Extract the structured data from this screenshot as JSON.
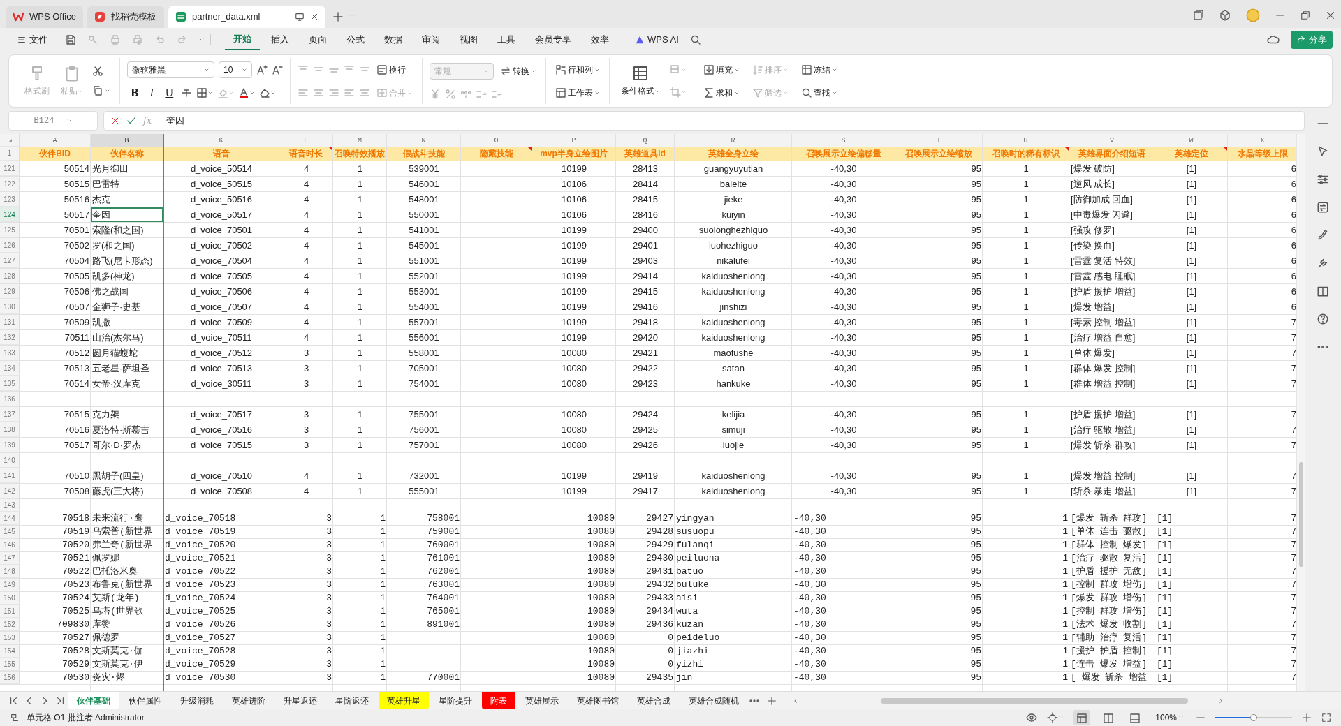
{
  "title_tabs": [
    {
      "label": "WPS Office",
      "selected": false
    },
    {
      "label": "找稻壳模板",
      "selected": false
    },
    {
      "label": "partner_data.xml",
      "selected": true
    }
  ],
  "menu": {
    "file": "文件",
    "tabs": [
      {
        "label": "开始",
        "selected": true
      },
      {
        "label": "插入",
        "selected": false
      },
      {
        "label": "页面",
        "selected": false
      },
      {
        "label": "公式",
        "selected": false
      },
      {
        "label": "数据",
        "selected": false
      },
      {
        "label": "审阅",
        "selected": false
      },
      {
        "label": "视图",
        "selected": false
      },
      {
        "label": "工具",
        "selected": false
      },
      {
        "label": "会员专享",
        "selected": false
      },
      {
        "label": "效率",
        "selected": false
      }
    ],
    "ai": "WPS AI",
    "share": "分享"
  },
  "ribbon": {
    "clipboard": [
      {
        "label": "格式刷",
        "disabled": true
      },
      {
        "label": "粘贴",
        "disabled": true
      }
    ],
    "font": {
      "family": "微软雅黑",
      "size": "10",
      "styles": [
        "B",
        "I",
        "U"
      ]
    },
    "align": [
      {
        "label": "换行",
        "disabled": false
      },
      {
        "label": "合并",
        "disabled": true
      }
    ],
    "number": {
      "format": "常规",
      "format_disabled": true,
      "convert": "转换"
    },
    "tools": [
      {
        "label": "行和列",
        "disabled": false
      },
      {
        "label": "工作表",
        "disabled": false
      }
    ],
    "conditional": "条件格式",
    "edit": [
      {
        "label": "填充",
        "disabled": false
      },
      {
        "label": "排序",
        "disabled": true
      },
      {
        "label": "冻结",
        "disabled": false
      },
      {
        "label": "求和",
        "disabled": false
      },
      {
        "label": "筛选",
        "disabled": true
      },
      {
        "label": "查找",
        "disabled": false
      }
    ]
  },
  "formula_bar": {
    "cell": "B124",
    "fx": "fx",
    "value": "奎因"
  },
  "sheet": {
    "columns": [
      {
        "letter": "A",
        "header": "伙伴BID",
        "comment": false,
        "selected": false
      },
      {
        "letter": "B",
        "header": "伙伴名称",
        "comment": false,
        "selected": true
      },
      {
        "letter": "K",
        "header": "语音",
        "comment": false,
        "selected": false
      },
      {
        "letter": "L",
        "header": "语音时长",
        "comment": true,
        "selected": false
      },
      {
        "letter": "M",
        "header": "召唤特效播放",
        "comment": false,
        "selected": false
      },
      {
        "letter": "N",
        "header": "假战斗技能",
        "comment": false,
        "selected": false
      },
      {
        "letter": "O",
        "header": "隐藏技能",
        "comment": true,
        "selected": false
      },
      {
        "letter": "P",
        "header": "mvp半身立绘图片",
        "comment": false,
        "selected": false
      },
      {
        "letter": "Q",
        "header": "英雄道具id",
        "comment": false,
        "selected": false
      },
      {
        "letter": "R",
        "header": "英雄全身立绘",
        "comment": false,
        "selected": false
      },
      {
        "letter": "S",
        "header": "召唤展示立绘偏移量",
        "comment": false,
        "selected": false
      },
      {
        "letter": "T",
        "header": "召唤展示立绘缩放",
        "comment": false,
        "selected": false
      },
      {
        "letter": "U",
        "header": "召唤时的稀有标识",
        "comment": true,
        "selected": false
      },
      {
        "letter": "V",
        "header": "英雄界面介绍短语",
        "comment": false,
        "selected": false
      },
      {
        "letter": "W",
        "header": "英雄定位",
        "comment": true,
        "selected": false
      },
      {
        "letter": "X",
        "header": "水晶等级上限",
        "comment": false,
        "selected": false
      }
    ],
    "header_row": "1",
    "rows": [
      {
        "row": "121",
        "kind": "standard",
        "selected": false,
        "cells": [
          "50514",
          "光月御田",
          "d_voice_50514",
          "4",
          "1",
          "539001",
          null,
          "10199",
          "28413",
          "guangyuyutian",
          "-40,30",
          "95",
          "1",
          "[爆发 破防]",
          "[1]",
          "6"
        ]
      },
      {
        "row": "122",
        "kind": "standard",
        "selected": false,
        "cells": [
          "50515",
          "巴雷特",
          "d_voice_50515",
          "4",
          "1",
          "546001",
          null,
          "10106",
          "28414",
          "baleite",
          "-40,30",
          "95",
          "1",
          "[逆风 成长]",
          "[1]",
          "6"
        ]
      },
      {
        "row": "123",
        "kind": "standard",
        "selected": false,
        "cells": [
          "50516",
          "杰克",
          "d_voice_50516",
          "4",
          "1",
          "548001",
          null,
          "10106",
          "28415",
          "jieke",
          "-40,30",
          "95",
          "1",
          "[防御加成 回血]",
          "[1]",
          "6"
        ]
      },
      {
        "row": "124",
        "kind": "standard",
        "selected": true,
        "cells": [
          "50517",
          "奎因",
          "d_voice_50517",
          "4",
          "1",
          "550001",
          null,
          "10106",
          "28416",
          "kuiyin",
          "-40,30",
          "95",
          "1",
          "[中毒爆发 闪避]",
          "[1]",
          "6"
        ]
      },
      {
        "row": "125",
        "kind": "standard",
        "selected": false,
        "cells": [
          "70501",
          "索隆(和之国)",
          "d_voice_70501",
          "4",
          "1",
          "541001",
          null,
          "10199",
          "29400",
          "suolonghezhiguo",
          "-40,30",
          "95",
          "1",
          "[强攻 修罗]",
          "[1]",
          "6"
        ]
      },
      {
        "row": "126",
        "kind": "standard",
        "selected": false,
        "cells": [
          "70502",
          "罗(和之国)",
          "d_voice_70502",
          "4",
          "1",
          "545001",
          null,
          "10199",
          "29401",
          "luohezhiguo",
          "-40,30",
          "95",
          "1",
          "[传染 换血]",
          "[1]",
          "6"
        ]
      },
      {
        "row": "127",
        "kind": "standard",
        "selected": false,
        "cells": [
          "70504",
          "路飞(尼卡形态)",
          "d_voice_70504",
          "4",
          "1",
          "551001",
          null,
          "10199",
          "29403",
          "nikalufei",
          "-40,30",
          "95",
          "1",
          "[雷霆 复活 特效]",
          "[1]",
          "6"
        ]
      },
      {
        "row": "128",
        "kind": "standard",
        "selected": false,
        "cells": [
          "70505",
          "凯多(神龙)",
          "d_voice_70505",
          "4",
          "1",
          "552001",
          null,
          "10199",
          "29414",
          "kaiduoshenlong",
          "-40,30",
          "95",
          "1",
          "[雷霆 感电 睡眠]",
          "[1]",
          "6"
        ]
      },
      {
        "row": "129",
        "kind": "standard",
        "selected": false,
        "cells": [
          "70506",
          "佛之战国",
          "d_voice_70506",
          "4",
          "1",
          "553001",
          null,
          "10199",
          "29415",
          "kaiduoshenlong",
          "-40,30",
          "95",
          "1",
          "[护盾 援护 增益]",
          "[1]",
          "6"
        ]
      },
      {
        "row": "130",
        "kind": "standard",
        "selected": false,
        "cells": [
          "70507",
          "金狮子·史基",
          "d_voice_70507",
          "4",
          "1",
          "554001",
          null,
          "10199",
          "29416",
          "jinshizi",
          "-40,30",
          "95",
          "1",
          "[爆发  增益]",
          "[1]",
          "6"
        ]
      },
      {
        "row": "131",
        "kind": "standard",
        "selected": false,
        "cells": [
          "70509",
          "凯撒",
          "d_voice_70509",
          "4",
          "1",
          "557001",
          null,
          "10199",
          "29418",
          "kaiduoshenlong",
          "-40,30",
          "95",
          "1",
          "[毒素 控制 增益]",
          "[1]",
          "7"
        ]
      },
      {
        "row": "132",
        "kind": "standard",
        "selected": false,
        "cells": [
          "70511",
          "山治(杰尔马)",
          "d_voice_70511",
          "4",
          "1",
          "556001",
          null,
          "10199",
          "29420",
          "kaiduoshenlong",
          "-40,30",
          "95",
          "1",
          "[治疗 增益 自愈]",
          "[1]",
          "7"
        ]
      },
      {
        "row": "133",
        "kind": "standard",
        "selected": false,
        "cells": [
          "70512",
          "圆月猫蝮蛇",
          "d_voice_70512",
          "3",
          "1",
          "558001",
          null,
          "10080",
          "29421",
          "maofushe",
          "-40,30",
          "95",
          "1",
          "[单体 爆发]",
          "[1]",
          "7"
        ]
      },
      {
        "row": "134",
        "kind": "standard",
        "selected": false,
        "cells": [
          "70513",
          "五老星·萨坦圣",
          "d_voice_70513",
          "3",
          "1",
          "705001",
          null,
          "10080",
          "29422",
          "satan",
          "-40,30",
          "95",
          "1",
          "[群体 爆发 控制]",
          "[1]",
          "7"
        ]
      },
      {
        "row": "135",
        "kind": "standard",
        "selected": false,
        "cells": [
          "70514",
          "女帝·汉库克",
          "d_voice_30511",
          "3",
          "1",
          "754001",
          null,
          "10080",
          "29423",
          "hankuke",
          "-40,30",
          "95",
          "1",
          "[群体 增益 控制]",
          "[1]",
          "7"
        ]
      },
      {
        "row": "136",
        "kind": "blank",
        "selected": false
      },
      {
        "row": "137",
        "kind": "standard",
        "selected": false,
        "cells": [
          "70515",
          "克力架",
          "d_voice_70517",
          "3",
          "1",
          "755001",
          null,
          "10080",
          "29424",
          "kelijia",
          "-40,30",
          "95",
          "1",
          "[护盾 援护 增益]",
          "[1]",
          "7"
        ]
      },
      {
        "row": "138",
        "kind": "standard",
        "selected": false,
        "cells": [
          "70516",
          "夏洛特·斯慕吉",
          "d_voice_70516",
          "3",
          "1",
          "756001",
          null,
          "10080",
          "29425",
          "simuji",
          "-40,30",
          "95",
          "1",
          "[治疗 驱散 增益]",
          "[1]",
          "7"
        ]
      },
      {
        "row": "139",
        "kind": "standard",
        "selected": false,
        "cells": [
          "70517",
          "哥尔·D·罗杰",
          "d_voice_70515",
          "3",
          "1",
          "757001",
          null,
          "10080",
          "29426",
          "luojie",
          "-40,30",
          "95",
          "1",
          "[爆发 斩杀 群攻]",
          "[1]",
          "7"
        ]
      },
      {
        "row": "140",
        "kind": "blank",
        "selected": false
      },
      {
        "row": "141",
        "kind": "standard",
        "selected": false,
        "cells": [
          "70510",
          "黑胡子(四皇)",
          "d_voice_70510",
          "4",
          "1",
          "732001",
          null,
          "10199",
          "29419",
          "kaiduoshenlong",
          "-40,30",
          "95",
          "1",
          "[爆发 增益 控制]",
          "[1]",
          "7"
        ]
      },
      {
        "row": "142",
        "kind": "standard",
        "selected": false,
        "cells": [
          "70508",
          "藤虎(三大将)",
          "d_voice_70508",
          "4",
          "1",
          "555001",
          null,
          "10199",
          "29417",
          "kaiduoshenlong",
          "-40,30",
          "95",
          "1",
          "[斩杀 暴走 增益]",
          "[1]",
          "7"
        ]
      },
      {
        "row": "143",
        "kind": "blank",
        "selected": false
      },
      {
        "row": "144",
        "kind": "plain",
        "selected": false,
        "cells": [
          "70518",
          "未来流行·鹰",
          "d_voice_70518",
          "3",
          "1",
          "758001",
          null,
          "10080",
          "29427",
          "yingyan",
          "-40,30",
          "95",
          "1",
          "[爆发 斩杀 群攻]",
          "[1]",
          "7"
        ]
      },
      {
        "row": "145",
        "kind": "plain",
        "selected": false,
        "cells": [
          "70519",
          "乌索普(新世界",
          "d_voice_70519",
          "3",
          "1",
          "759001",
          null,
          "10080",
          "29428",
          "susuopu",
          "-40,30",
          "95",
          "1",
          "[单体 连击 驱散]",
          "[1]",
          "7"
        ]
      },
      {
        "row": "146",
        "kind": "plain",
        "selected": false,
        "cells": [
          "70520",
          "弗兰奇(新世界",
          "d_voice_70520",
          "3",
          "1",
          "760001",
          null,
          "10080",
          "29429",
          "fulanqi",
          "-40,30",
          "95",
          "1",
          "[群体 控制 爆发]",
          "[1]",
          "7"
        ]
      },
      {
        "row": "147",
        "kind": "plain",
        "selected": false,
        "cells": [
          "70521",
          "佩罗娜",
          "d_voice_70521",
          "3",
          "1",
          "761001",
          null,
          "10080",
          "29430",
          "peiluona",
          "-40,30",
          "95",
          "1",
          "[治疗 驱散 复活]",
          "[1]",
          "7"
        ]
      },
      {
        "row": "148",
        "kind": "plain",
        "selected": false,
        "cells": [
          "70522",
          "巴托洛米奥",
          "d_voice_70522",
          "3",
          "1",
          "762001",
          null,
          "10080",
          "29431",
          "batuo",
          "-40,30",
          "95",
          "1",
          "[护盾 援护 无敌]",
          "[1]",
          "7"
        ]
      },
      {
        "row": "149",
        "kind": "plain",
        "selected": false,
        "cells": [
          "70523",
          "布鲁克(新世界",
          "d_voice_70523",
          "3",
          "1",
          "763001",
          null,
          "10080",
          "29432",
          "buluke",
          "-40,30",
          "95",
          "1",
          "[控制 群攻 增伤]",
          "[1]",
          "7"
        ]
      },
      {
        "row": "150",
        "kind": "plain",
        "selected": false,
        "cells": [
          "70524",
          "艾斯(龙年)",
          "d_voice_70524",
          "3",
          "1",
          "764001",
          null,
          "10080",
          "29433",
          "aisi",
          "-40,30",
          "95",
          "1",
          "[爆发 群攻 增伤]",
          "[1]",
          "7"
        ]
      },
      {
        "row": "151",
        "kind": "plain",
        "selected": false,
        "cells": [
          "70525",
          "乌塔(世界歌",
          "d_voice_70525",
          "3",
          "1",
          "765001",
          null,
          "10080",
          "29434",
          "wuta",
          "-40,30",
          "95",
          "1",
          "[控制 群攻 增伤]",
          "[1]",
          "7"
        ]
      },
      {
        "row": "152",
        "kind": "plain",
        "selected": false,
        "cells": [
          "709830",
          "库赞",
          "d_voice_70526",
          "3",
          "1",
          "891001",
          null,
          "10080",
          "29436",
          "kuzan",
          "-40,30",
          "95",
          "1",
          "[法术 爆发 收割]",
          "[1]",
          "7"
        ]
      },
      {
        "row": "153",
        "kind": "plain",
        "selected": false,
        "cells": [
          "70527",
          "佩德罗",
          "d_voice_70527",
          "3",
          "1",
          null,
          null,
          "10080",
          "0",
          "peideluo",
          "-40,30",
          "95",
          "1",
          "[辅助 治疗 复活]",
          "[1]",
          "7"
        ]
      },
      {
        "row": "154",
        "kind": "plain",
        "selected": false,
        "cells": [
          "70528",
          "文斯莫克·伽",
          "d_voice_70528",
          "3",
          "1",
          null,
          null,
          "10080",
          "0",
          "jiazhi",
          "-40,30",
          "95",
          "1",
          "[援护 护盾 控制]",
          "[1]",
          "7"
        ]
      },
      {
        "row": "155",
        "kind": "plain",
        "selected": false,
        "cells": [
          "70529",
          "文斯莫克·伊",
          "d_voice_70529",
          "3",
          "1",
          null,
          null,
          "10080",
          "0",
          "yizhi",
          "-40,30",
          "95",
          "1",
          "[连击 爆发 增益]",
          "[1]",
          "7"
        ]
      },
      {
        "row": "156",
        "kind": "plain",
        "selected": false,
        "cells": [
          "70530",
          "炎灾·烬",
          "d_voice_70530",
          "3",
          "1",
          "770001",
          null,
          "10080",
          "29435",
          "jin",
          "-40,30",
          "95",
          "1",
          "[ 爆发 斩杀 增益",
          "[1]",
          "7"
        ]
      }
    ]
  },
  "sheet_tabs": [
    {
      "label": "伙伴基础",
      "selected": true
    },
    {
      "label": "伙伴属性",
      "selected": false
    },
    {
      "label": "升级消耗",
      "selected": false
    },
    {
      "label": "英雄进阶",
      "selected": false
    },
    {
      "label": "升星返还",
      "selected": false
    },
    {
      "label": "星阶返还",
      "selected": false
    },
    {
      "label": "英雄升星",
      "selected": false,
      "color": "#ffff00"
    },
    {
      "label": "星阶提升",
      "selected": false
    },
    {
      "label": "附表",
      "selected": false,
      "color": "#ff0000"
    },
    {
      "label": "英雄展示",
      "selected": false
    },
    {
      "label": "英雄图书馆",
      "selected": false
    },
    {
      "label": "英雄合成",
      "selected": false
    },
    {
      "label": "英雄合成随机",
      "selected": false
    }
  ],
  "status_bar": {
    "text": "单元格 O1 批注者 Administrator",
    "zoom": "100%",
    "zoom_slider": {
      "level": 0.5
    }
  }
}
